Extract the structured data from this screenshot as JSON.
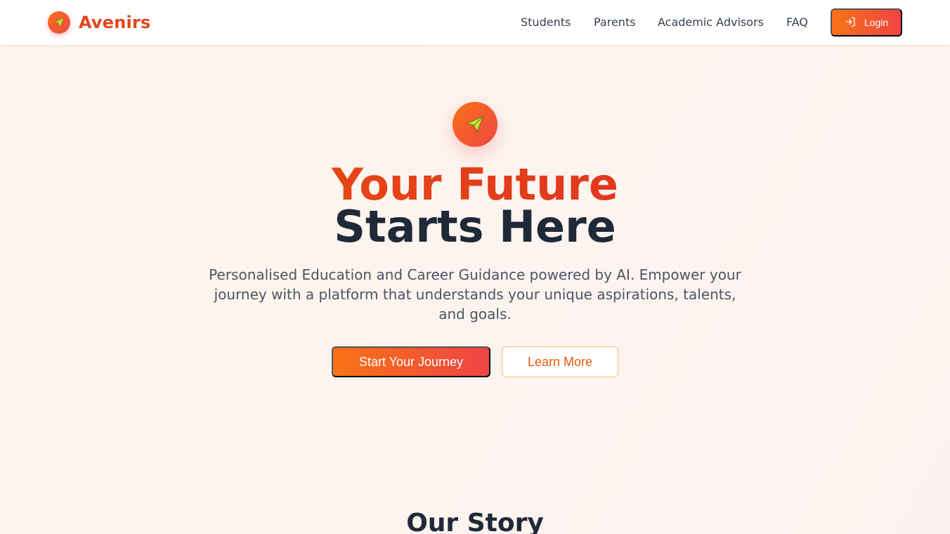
{
  "brand": {
    "name": "Avenirs",
    "logo_icon": "paper-plane-icon"
  },
  "nav": {
    "links": [
      "Students",
      "Parents",
      "Academic Advisors",
      "FAQ"
    ],
    "login_label": "Login",
    "login_icon": "login-arrow-icon"
  },
  "hero": {
    "icon": "paper-plane-icon",
    "title_line1": "Your Future",
    "title_line2": "Starts Here",
    "subtitle": "Personalised Education and Career Guidance powered by AI. Empower your journey with a platform that understands your unique aspirations, talents, and goals.",
    "primary_button": "Start Your Journey",
    "secondary_button": "Learn More"
  },
  "story": {
    "title": "Our Story"
  },
  "colors": {
    "accent_orange": "#f97316",
    "accent_red": "#ef4444",
    "brand_text": "#e2461f",
    "dark_text": "#1f2937"
  }
}
